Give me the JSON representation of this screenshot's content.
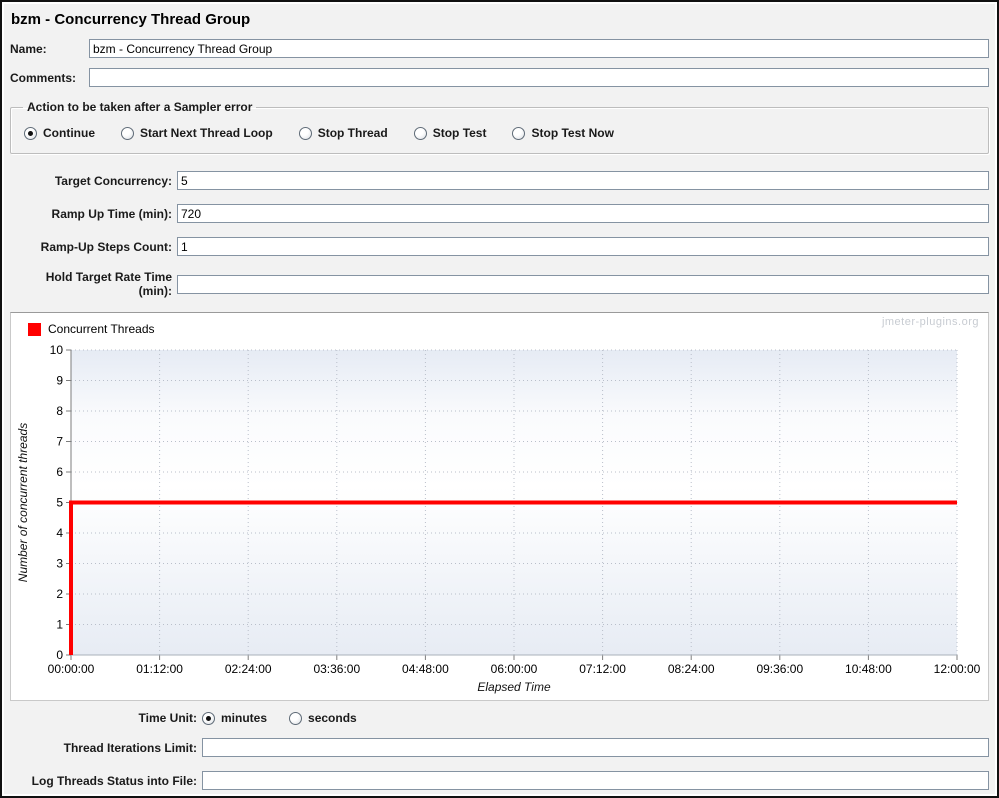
{
  "title": "bzm - Concurrency Thread Group",
  "fields": {
    "name": {
      "label": "Name:",
      "value": "bzm - Concurrency Thread Group"
    },
    "comments": {
      "label": "Comments:",
      "value": ""
    }
  },
  "sampler_error": {
    "title": "Action to be taken after a Sampler error",
    "options": [
      {
        "label": "Continue",
        "selected": true
      },
      {
        "label": "Start Next Thread Loop",
        "selected": false
      },
      {
        "label": "Stop Thread",
        "selected": false
      },
      {
        "label": "Stop Test",
        "selected": false
      },
      {
        "label": "Stop Test Now",
        "selected": false
      }
    ]
  },
  "form": {
    "target_concurrency": {
      "label": "Target Concurrency:",
      "value": "5"
    },
    "ramp_up_time": {
      "label": "Ramp Up Time (min):",
      "value": "720"
    },
    "ramp_up_steps": {
      "label": "Ramp-Up Steps Count:",
      "value": "1"
    },
    "hold_target_rate": {
      "label": "Hold Target Rate Time (min):",
      "value": ""
    }
  },
  "bottom_form": {
    "time_unit": {
      "label": "Time Unit:",
      "options": [
        {
          "label": "minutes",
          "selected": true
        },
        {
          "label": "seconds",
          "selected": false
        }
      ]
    },
    "thread_iterations_limit": {
      "label": "Thread Iterations Limit:",
      "value": ""
    },
    "log_threads_status": {
      "label": "Log Threads Status into File:",
      "value": ""
    }
  },
  "chart_data": {
    "type": "line",
    "title": "",
    "legend": [
      {
        "name": "Concurrent Threads",
        "color": "#ff0000"
      }
    ],
    "watermark": "jmeter-plugins.org",
    "xlabel": "Elapsed Time",
    "ylabel": "Number of concurrent threads",
    "x_ticks": [
      "00:00:00",
      "01:12:00",
      "02:24:00",
      "03:36:00",
      "04:48:00",
      "06:00:00",
      "07:12:00",
      "08:24:00",
      "09:36:00",
      "10:48:00",
      "12:00:00"
    ],
    "y_ticks": [
      0,
      1,
      2,
      3,
      4,
      5,
      6,
      7,
      8,
      9,
      10
    ],
    "xlim_seconds": [
      0,
      43200
    ],
    "ylim": [
      0,
      10
    ],
    "grid": "dotted",
    "legend_position": "top-left",
    "series": [
      {
        "name": "Concurrent Threads",
        "color": "#ff0000",
        "points_time_seconds_vs_threads": [
          [
            0,
            0
          ],
          [
            0,
            5
          ],
          [
            43200,
            5
          ]
        ]
      }
    ]
  }
}
